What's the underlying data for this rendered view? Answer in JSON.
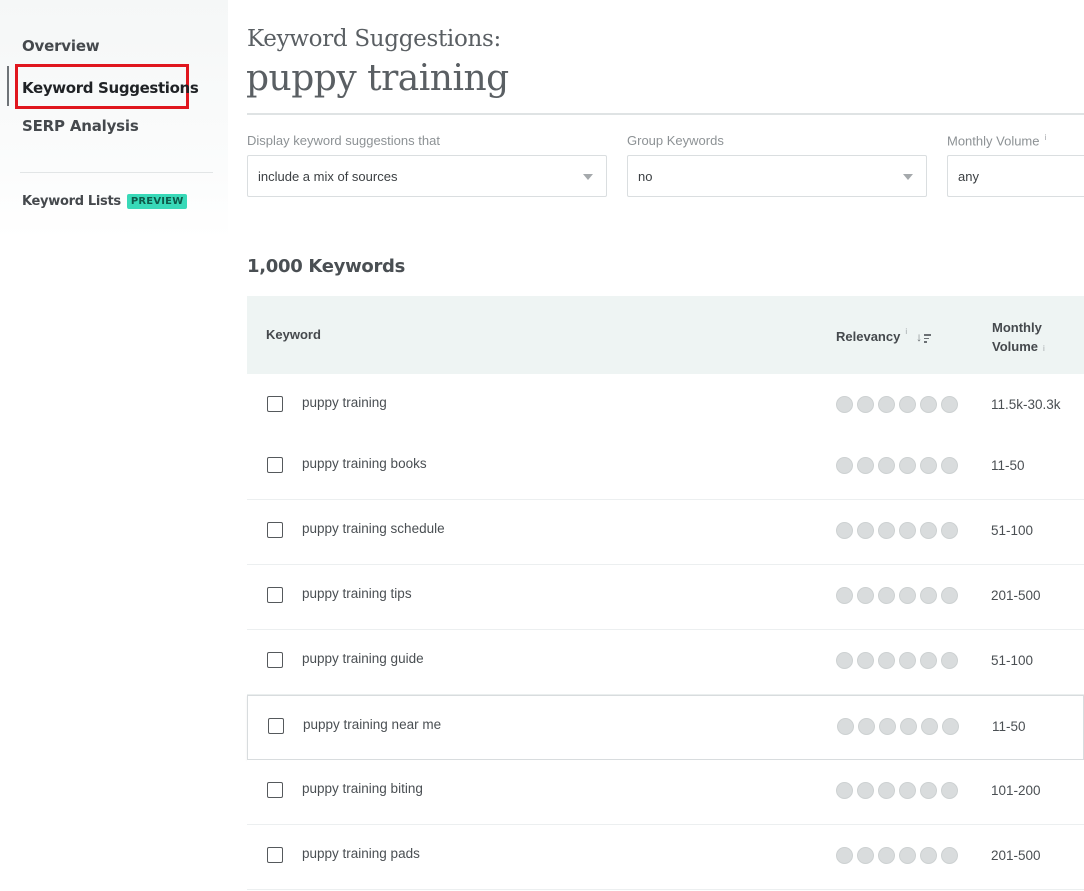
{
  "sidebar": {
    "overview": "Overview",
    "keyword_suggestions": "Keyword Suggestions",
    "serp_analysis": "SERP Analysis",
    "keyword_lists": "Keyword Lists",
    "preview_badge": "PREVIEW"
  },
  "header": {
    "label": "Keyword Suggestions:",
    "query": "puppy training"
  },
  "filters": {
    "display": {
      "label": "Display keyword suggestions that",
      "value": "include a mix of sources"
    },
    "group": {
      "label": "Group Keywords",
      "value": "no"
    },
    "volume": {
      "label": "Monthly Volume",
      "info": "i",
      "value": "any"
    }
  },
  "results": {
    "count_label": "1,000 Keywords"
  },
  "table": {
    "headers": {
      "keyword": "Keyword",
      "relevancy": "Relevancy",
      "relevancy_info": "i",
      "volume_line1": "Monthly",
      "volume_line2": "Volume",
      "volume_info": "i"
    },
    "rows": [
      {
        "keyword": "puppy training",
        "volume": "11.5k-30.3k"
      },
      {
        "keyword": "puppy training books",
        "volume": "11-50"
      },
      {
        "keyword": "puppy training schedule",
        "volume": "51-100"
      },
      {
        "keyword": "puppy training tips",
        "volume": "201-500"
      },
      {
        "keyword": "puppy training guide",
        "volume": "51-100"
      },
      {
        "keyword": "puppy training near me",
        "volume": "11-50"
      },
      {
        "keyword": "puppy training biting",
        "volume": "101-200"
      },
      {
        "keyword": "puppy training pads",
        "volume": "201-500"
      }
    ]
  },
  "colors": {
    "highlight_box": "#e0161e",
    "preview_badge": "#38d9b8",
    "table_header_bg": "#eef4f3"
  },
  "icons": {
    "sort": "sort-descending-icon",
    "dropdown": "chevron-down-icon",
    "relevancy_dot": "relevancy-dot-icon"
  }
}
